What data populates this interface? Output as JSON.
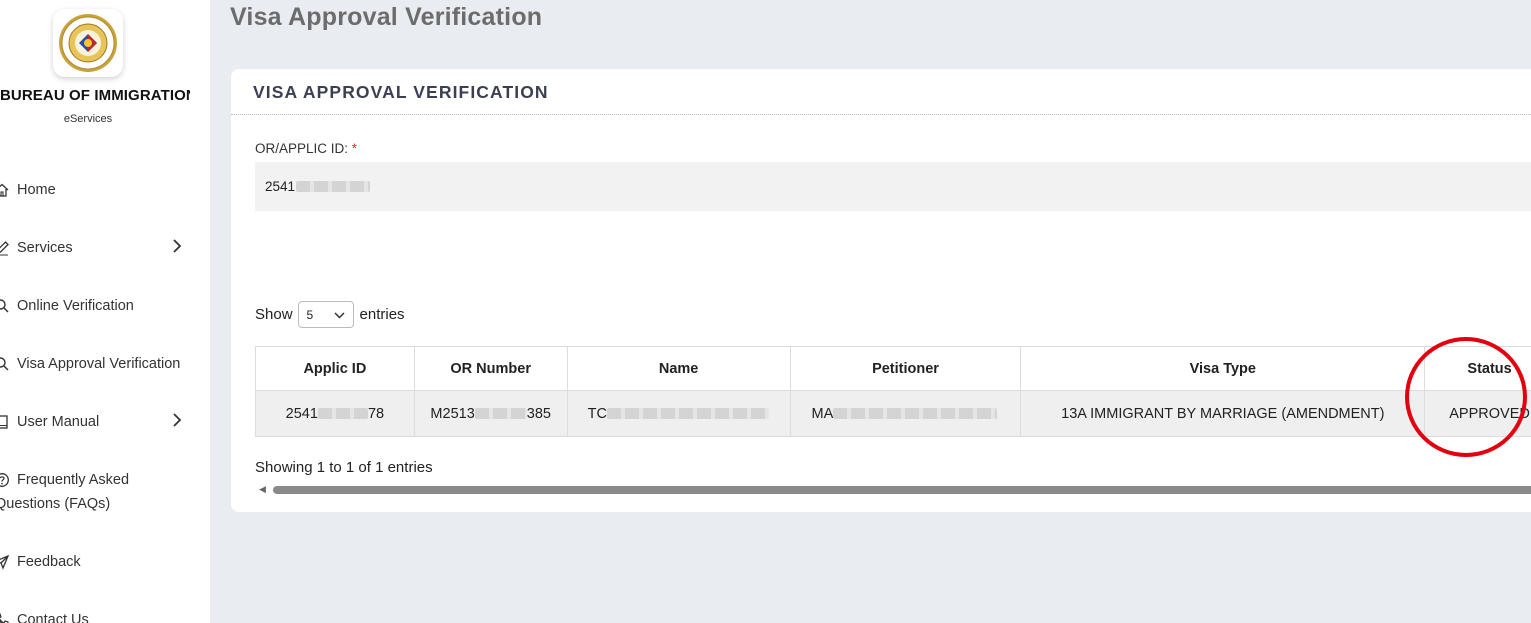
{
  "sidebar": {
    "brand_title": "BUREAU OF IMMIGRATION",
    "brand_subtitle": "eServices",
    "items": [
      {
        "label": "Home",
        "icon": "home-icon"
      },
      {
        "label": "Services",
        "icon": "edit-icon",
        "has_children": true
      },
      {
        "label": "Online Verification",
        "icon": "search-icon"
      },
      {
        "label": "Visa Approval Verification",
        "icon": "search-icon"
      },
      {
        "label": "User Manual",
        "icon": "book-icon",
        "has_children": true
      },
      {
        "label": "Frequently Asked",
        "label2": "Questions (FAQs)",
        "icon": "question-icon"
      },
      {
        "label": "Feedback",
        "icon": "send-icon"
      },
      {
        "label": "Contact Us",
        "icon": "phone-icon"
      }
    ]
  },
  "page": {
    "title": "Visa Approval Verification"
  },
  "card": {
    "title": "VISA APPROVAL VERIFICATION",
    "field_label": "OR/APPLIC ID:",
    "required_mark": "*",
    "field_value_visible": "2541"
  },
  "table": {
    "show_label": "Show",
    "entries_label": "entries",
    "page_size": "5",
    "columns": [
      "Applic ID",
      "OR Number",
      "Name",
      "Petitioner",
      "Visa Type",
      "Status"
    ],
    "row": {
      "applic_id_start": "2541",
      "applic_id_end": "78",
      "or_number_start": "M2513",
      "or_number_end": "385",
      "name_start": "TC",
      "petitioner_start": "MA",
      "visa_type": "13A IMMIGRANT BY MARRIAGE (AMENDMENT)",
      "status": "APPROVED"
    },
    "info": "Showing 1 to 1 of 1 entries"
  },
  "colors": {
    "accent": "#e3000f",
    "background": "#e9ecf1",
    "title_gray": "#6c6c6c",
    "card_title": "#3a3f52"
  }
}
